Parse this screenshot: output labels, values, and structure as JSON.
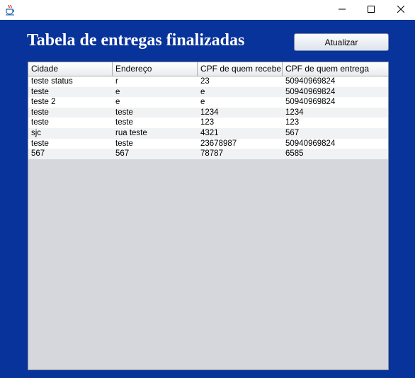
{
  "window": {
    "icon": "java-coffee-cup-icon",
    "controls": [
      "minimize-icon",
      "maximize-icon",
      "close-icon"
    ]
  },
  "page": {
    "title": "Tabela de entregas finalizadas",
    "refresh_label": "Atualizar"
  },
  "colors": {
    "background": "#08339a",
    "table_empty": "#d6d7dd"
  },
  "table": {
    "columns": [
      "Cidade",
      "Endereço",
      "CPF de quem recebe",
      "CPF de quem entrega"
    ],
    "rows": [
      [
        "teste status",
        "r",
        "23",
        "50940969824"
      ],
      [
        "teste",
        "e",
        "e",
        "50940969824"
      ],
      [
        "teste 2",
        "e",
        "e",
        "50940969824"
      ],
      [
        "teste",
        "teste",
        "1234",
        "1234"
      ],
      [
        "teste",
        "teste",
        "123",
        "123"
      ],
      [
        "sjc",
        "rua teste",
        "4321",
        "567"
      ],
      [
        "teste",
        "teste",
        "23678987",
        "50940969824"
      ],
      [
        "567",
        "567",
        "78787",
        "6585"
      ]
    ]
  }
}
